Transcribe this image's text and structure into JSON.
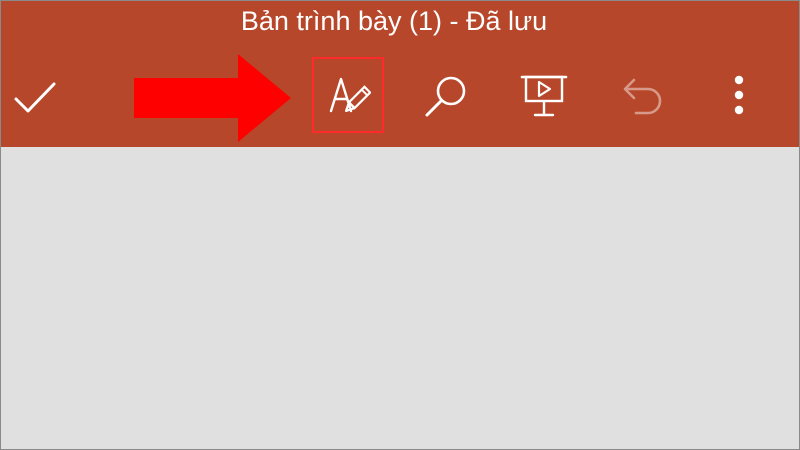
{
  "app_bar": {
    "title": "Bản trình bày (1) - Đã lưu",
    "background_color": "#B7472A"
  },
  "toolbar": {
    "done_icon": "checkmark-icon",
    "edit_icon": "text-edit-pen-icon",
    "search_icon": "search-icon",
    "present_icon": "slideshow-play-icon",
    "undo_icon": "undo-icon",
    "more_icon": "more-vertical-icon",
    "undo_enabled": false
  },
  "annotation": {
    "arrow_color": "#FF0000",
    "highlight_color": "#FF2A2A"
  },
  "content": {
    "background_color": "#E0E0E0"
  }
}
